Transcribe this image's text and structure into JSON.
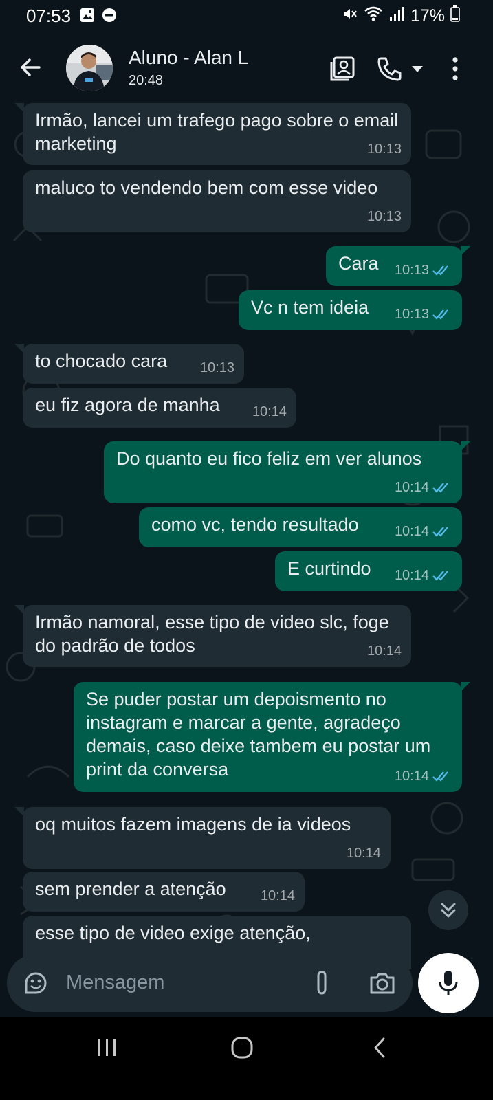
{
  "status_bar": {
    "time": "07:53",
    "battery": "17%",
    "icons": [
      "image-icon",
      "dnd-icon",
      "mute-icon",
      "wifi-icon",
      "signal-icon",
      "battery-icon"
    ]
  },
  "header": {
    "contact_name": "Aluno - Alan L",
    "subtitle": "20:48",
    "icons": [
      "back-arrow-icon",
      "avatar",
      "contact-card-icon",
      "phone-icon",
      "dropdown-icon",
      "more-vert-icon"
    ]
  },
  "messages": [
    {
      "dir": "in",
      "text": "Irmão, lancei um trafego pago sobre o email marketing",
      "time": "10:13"
    },
    {
      "dir": "in",
      "text": "maluco to vendendo bem com esse video",
      "time": "10:13"
    },
    {
      "dir": "out",
      "text": "Cara",
      "time": "10:13"
    },
    {
      "dir": "out",
      "text": "Vc n tem ideia",
      "time": "10:13"
    },
    {
      "dir": "in",
      "text": "to chocado cara",
      "time": "10:13"
    },
    {
      "dir": "in",
      "text": "eu fiz agora de manha",
      "time": "10:14"
    },
    {
      "dir": "out",
      "text": "Do quanto eu fico feliz em ver alunos",
      "time": "10:14"
    },
    {
      "dir": "out",
      "text": "como vc, tendo resultado",
      "time": "10:14"
    },
    {
      "dir": "out",
      "text": "E curtindo",
      "time": "10:14"
    },
    {
      "dir": "in",
      "text": "Irmão namoral, esse tipo de video slc, foge do padrão de todos",
      "time": "10:14"
    },
    {
      "dir": "out",
      "text": "Se puder postar um depoismento no instagram e marcar a gente, agradeço demais, caso deixe tambem eu postar um print da conversa",
      "time": "10:14"
    },
    {
      "dir": "in",
      "text": "oq muitos fazem imagens de ia videos",
      "time": "10:14"
    },
    {
      "dir": "in",
      "text": "sem prender a atenção",
      "time": "10:14"
    },
    {
      "dir": "in",
      "text": "esse tipo de video exige atenção,",
      "time": ""
    }
  ],
  "composer": {
    "placeholder": "Mensagem"
  },
  "colors": {
    "background": "#0b141a",
    "incoming_bubble": "#202c33",
    "outgoing_bubble": "#005c4b",
    "read_ticks": "#53bdeb"
  }
}
